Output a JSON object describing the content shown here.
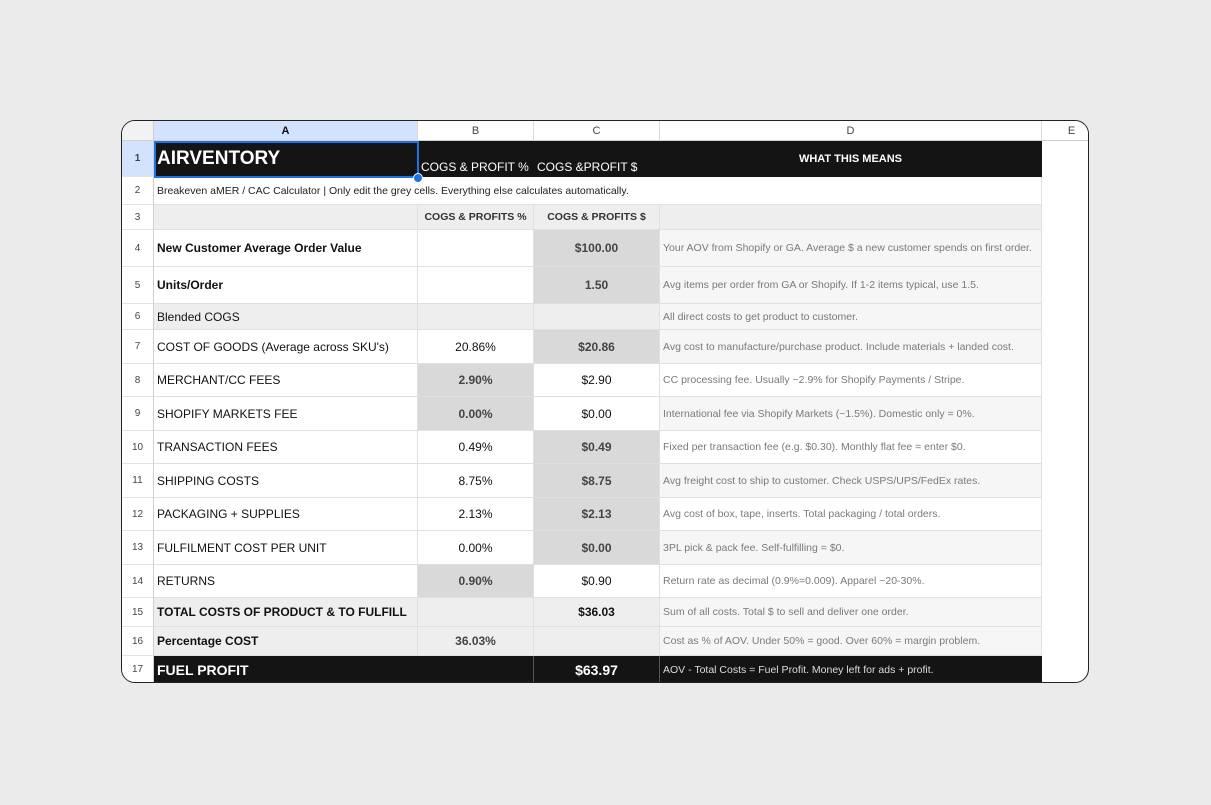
{
  "columns": [
    "A",
    "B",
    "C",
    "D",
    "E"
  ],
  "rows": [
    "1",
    "2",
    "3",
    "4",
    "5",
    "6",
    "7",
    "8",
    "9",
    "10",
    "11",
    "12",
    "13",
    "14",
    "15",
    "16",
    "17"
  ],
  "r1": {
    "a": "AIRVENTORY",
    "b": "COGS & PROFIT %",
    "c": "COGS &PROFIT $",
    "d": "WHAT THIS MEANS"
  },
  "r2": {
    "a": "Breakeven aMER / CAC Calculator  |  Only edit the grey cells. Everything else calculates automatically."
  },
  "r3": {
    "b": "COGS & PROFITS %",
    "c": "COGS & PROFITS $"
  },
  "items": [
    {
      "a": "New Customer Average Order Value",
      "b": "",
      "c": "$100.00",
      "d": "Your AOV from Shopify or GA. Average $ a new customer spends on first order."
    },
    {
      "a": "Units/Order",
      "b": "",
      "c": "1.50",
      "d": "Avg items per order from GA or Shopify. If 1-2 items typical, use 1.5."
    },
    {
      "a": "Blended COGS",
      "b": "",
      "c": "",
      "d": "All direct costs to get product to customer."
    },
    {
      "a": "COST OF GOODS (Average across SKU's)",
      "b": "20.86%",
      "c": "$20.86",
      "d": "Avg cost to manufacture/purchase product. Include materials + landed cost."
    },
    {
      "a": "MERCHANT/CC FEES",
      "b": "2.90%",
      "c": "$2.90",
      "d": "CC processing fee. Usually ~2.9% for Shopify Payments / Stripe."
    },
    {
      "a": "SHOPIFY MARKETS FEE",
      "b": "0.00%",
      "c": "$0.00",
      "d": "International fee via Shopify Markets (~1.5%). Domestic only = 0%."
    },
    {
      "a": "TRANSACTION FEES",
      "b": "0.49%",
      "c": "$0.49",
      "d": "Fixed per transaction fee (e.g. $0.30). Monthly flat fee = enter $0."
    },
    {
      "a": "SHIPPING COSTS",
      "b": "8.75%",
      "c": "$8.75",
      "d": "Avg freight cost to ship to customer. Check USPS/UPS/FedEx rates."
    },
    {
      "a": "PACKAGING + SUPPLIES",
      "b": "2.13%",
      "c": "$2.13",
      "d": "Avg cost of box, tape, inserts. Total packaging / total orders."
    },
    {
      "a": "FULFILMENT COST PER UNIT",
      "b": "0.00%",
      "c": "$0.00",
      "d": "3PL pick & pack fee. Self-fulfilling = $0."
    },
    {
      "a": "RETURNS",
      "b": "0.90%",
      "c": "$0.90",
      "d": "Return rate as decimal (0.9%=0.009). Apparel ~20-30%."
    },
    {
      "a": "TOTAL COSTS OF PRODUCT & TO FULFILL",
      "b": "",
      "c": "$36.03",
      "d": "Sum of all costs. Total $ to sell and deliver one order."
    },
    {
      "a": "Percentage COST",
      "b": "36.03%",
      "c": "",
      "d": "Cost as % of AOV. Under 50% = good. Over 60% = margin problem."
    },
    {
      "a": "FUEL PROFIT",
      "b": "",
      "c": "$63.97",
      "d": "AOV - Total Costs = Fuel Profit. Money left for ads + profit."
    }
  ]
}
